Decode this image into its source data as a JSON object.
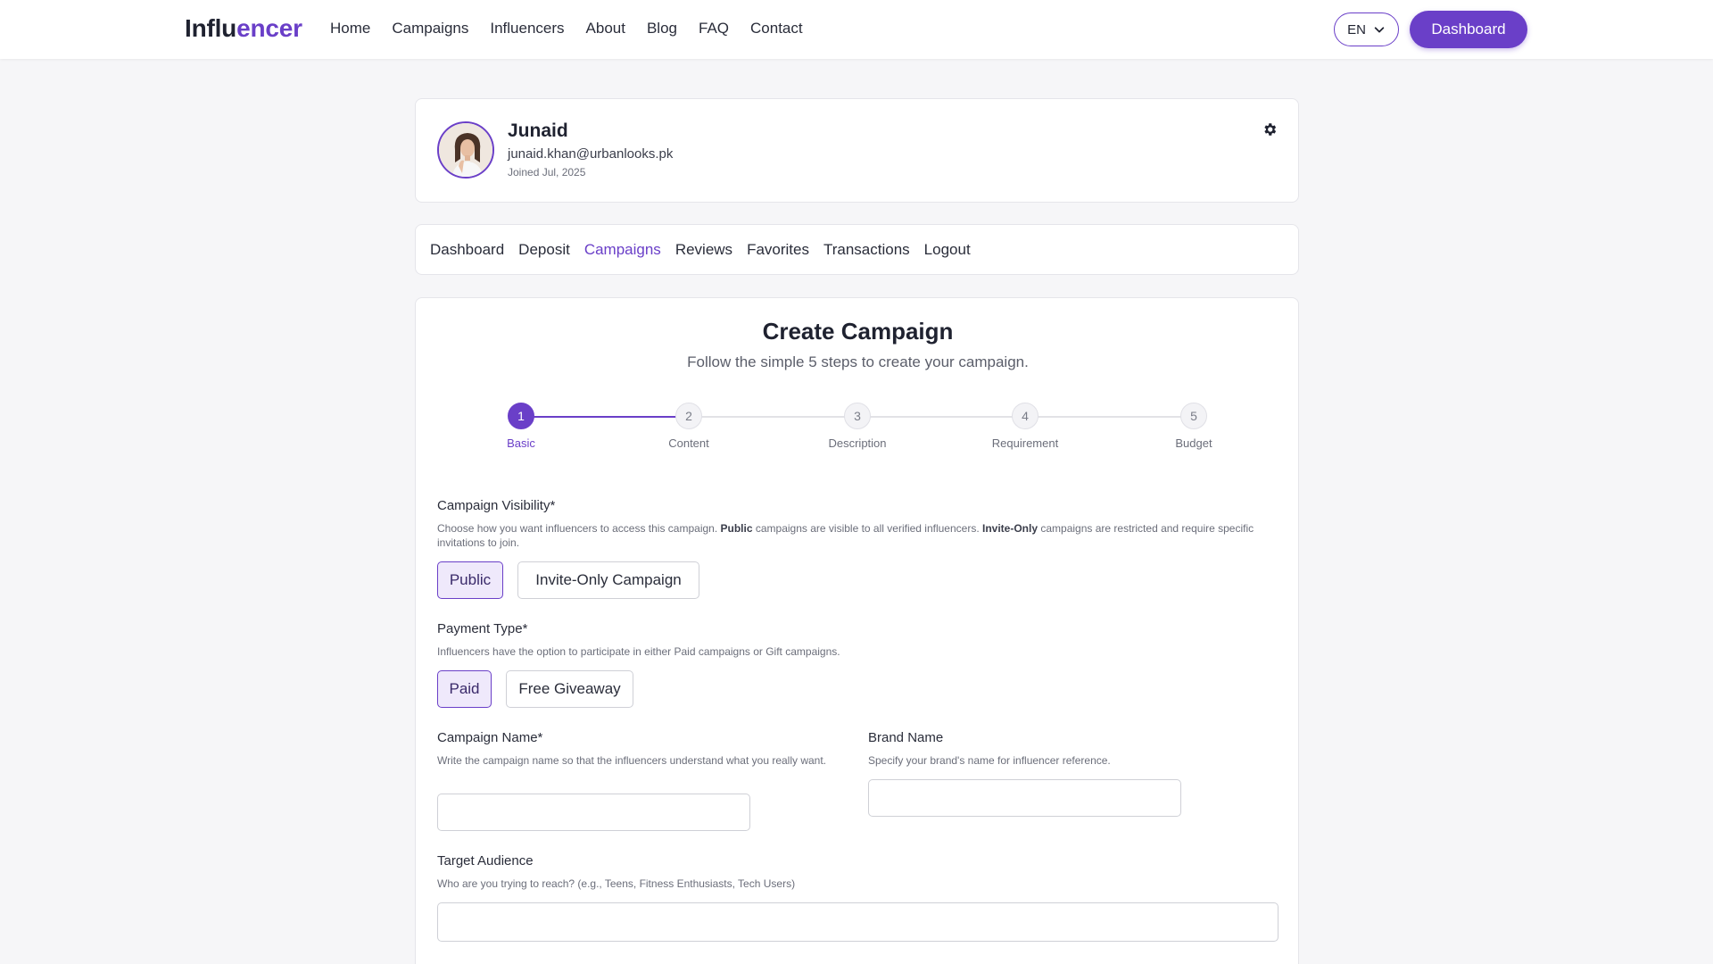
{
  "header": {
    "logo_part1": "Influ",
    "logo_part2": "encer",
    "nav": [
      "Home",
      "Campaigns",
      "Influencers",
      "About",
      "Blog",
      "FAQ",
      "Contact"
    ],
    "language": "EN",
    "dashboard_button": "Dashboard"
  },
  "profile": {
    "name": "Junaid",
    "email": "junaid.khan@urbanlooks.pk",
    "joined": "Joined Jul, 2025"
  },
  "tabs": {
    "items": [
      "Dashboard",
      "Deposit",
      "Campaigns",
      "Reviews",
      "Favorites",
      "Transactions",
      "Logout"
    ],
    "active": "Campaigns"
  },
  "form": {
    "title": "Create Campaign",
    "subtitle": "Follow the simple 5 steps to create your campaign.",
    "steps": [
      {
        "num": "1",
        "label": "Basic"
      },
      {
        "num": "2",
        "label": "Content"
      },
      {
        "num": "3",
        "label": "Description"
      },
      {
        "num": "4",
        "label": "Requirement"
      },
      {
        "num": "5",
        "label": "Budget"
      }
    ],
    "current_step": 1,
    "visibility": {
      "label": "Campaign Visibility*",
      "hint_a": "Choose how you want influencers to access this campaign. ",
      "hint_b": "Public",
      "hint_c": " campaigns are visible to all verified influencers. ",
      "hint_d": "Invite-Only",
      "hint_e": " campaigns are restricted and require specific invitations to join.",
      "options": [
        "Public",
        "Invite-Only Campaign"
      ],
      "selected": "Public"
    },
    "payment": {
      "label": "Payment Type*",
      "hint": "Influencers have the option to participate in either Paid campaigns or Gift campaigns.",
      "options": [
        "Paid",
        "Free Giveaway"
      ],
      "selected": "Paid"
    },
    "campaign_name": {
      "label": "Campaign Name*",
      "hint": "Write the campaign name so that the influencers understand what you really want.",
      "value": ""
    },
    "brand_name": {
      "label": "Brand Name",
      "hint": "Specify your brand's name for influencer reference.",
      "value": ""
    },
    "target_audience": {
      "label": "Target Audience",
      "hint": "Who are you trying to reach? (e.g., Teens, Fitness Enthusiasts, Tech Users)",
      "value": ""
    }
  },
  "colors": {
    "accent": "#6a3fc8",
    "selected_bg": "#efe9fb",
    "page_bg": "#f6f6f8"
  }
}
